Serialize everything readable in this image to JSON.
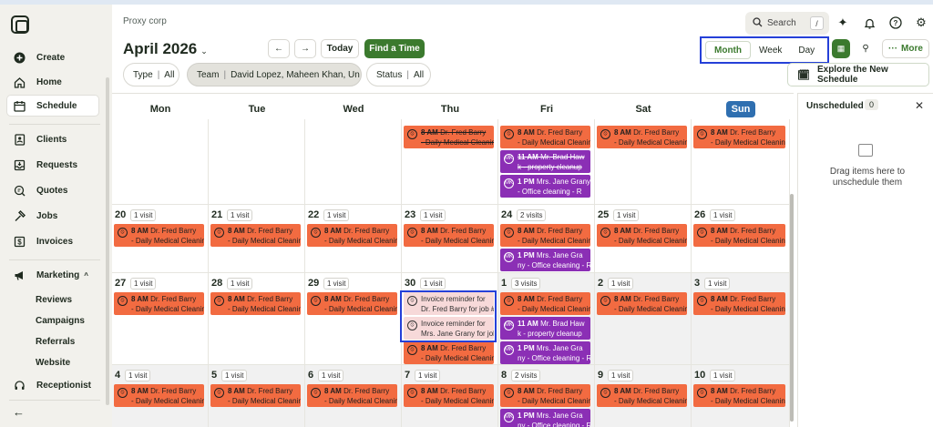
{
  "company": "Proxy corp",
  "header": {
    "month_label": "April 2026",
    "prev_icon": "arrow-left-icon",
    "next_icon": "arrow-right-icon",
    "today_label": "Today",
    "find_time_label": "Find a Time",
    "search_placeholder": "Search",
    "search_shortcut": "/",
    "views": [
      "Month",
      "Week",
      "Day"
    ],
    "active_view": "Month",
    "more_label": "More",
    "explore_label": "Explore the New Schedule"
  },
  "filters": {
    "type": {
      "label": "Type",
      "value": "All"
    },
    "team": {
      "label": "Team",
      "value": "David Lopez, Maheen Khan, Un"
    },
    "status": {
      "label": "Status",
      "value": "All"
    }
  },
  "sidebar": {
    "items": [
      {
        "label": "Create",
        "icon": "plus-circle-icon"
      },
      {
        "label": "Home",
        "icon": "home-icon"
      },
      {
        "label": "Schedule",
        "icon": "calendar-icon"
      },
      {
        "label": "Clients",
        "icon": "contacts-icon"
      },
      {
        "label": "Requests",
        "icon": "inbox-icon"
      },
      {
        "label": "Quotes",
        "icon": "quote-icon"
      },
      {
        "label": "Jobs",
        "icon": "hammer-icon"
      },
      {
        "label": "Invoices",
        "icon": "dollar-icon"
      },
      {
        "label": "Marketing",
        "icon": "megaphone-icon"
      }
    ],
    "marketing_sub": [
      "Reviews",
      "Campaigns",
      "Referrals",
      "Website"
    ],
    "receptionist_label": "Receptionist",
    "active": "Schedule"
  },
  "calendar": {
    "weekdays": [
      "Mon",
      "Tue",
      "Wed",
      "Thu",
      "Fri",
      "Sat",
      "Sun"
    ],
    "today_weekday": "Sun",
    "weeks": [
      {
        "days": [
          {
            "num": "",
            "count": "",
            "events": []
          },
          {
            "num": "",
            "count": "",
            "events": []
          },
          {
            "num": "",
            "count": "",
            "events": []
          },
          {
            "num": "",
            "count": "",
            "events": [
              {
                "c": "or",
                "t": "8 AM",
                "l1": "Dr. Fred Barry",
                "l2": "- Daily Medical Cleanin",
                "strike": true
              }
            ]
          },
          {
            "num": "",
            "count": "",
            "events": [
              {
                "c": "or",
                "t": "8 AM",
                "l1": "Dr. Fred Barry",
                "l2": "- Daily Medical Cleanin"
              },
              {
                "c": "pu",
                "t": "11 AM",
                "l1": "Mr. Brad Haw",
                "l2": "k - property cleanup",
                "strike": true
              },
              {
                "c": "pu",
                "t": "1 PM",
                "l1": "Mrs. Jane Grany",
                "l2": "- Office cleaning - R"
              }
            ]
          },
          {
            "num": "",
            "count": "",
            "events": [
              {
                "c": "or",
                "t": "8 AM",
                "l1": "Dr. Fred Barry",
                "l2": "- Daily Medical Cleanin"
              }
            ]
          },
          {
            "num": "",
            "count": "",
            "events": [
              {
                "c": "or",
                "t": "8 AM",
                "l1": "Dr. Fred Barry",
                "l2": "- Daily Medical Cleanin"
              }
            ]
          }
        ]
      },
      {
        "days": [
          {
            "num": "20",
            "count": "1 visit",
            "events": [
              {
                "c": "or",
                "t": "8 AM",
                "l1": "Dr. Fred Barry",
                "l2": "- Daily Medical Cleanin"
              }
            ]
          },
          {
            "num": "21",
            "count": "1 visit",
            "events": [
              {
                "c": "or",
                "t": "8 AM",
                "l1": "Dr. Fred Barry",
                "l2": "- Daily Medical Cleanin"
              }
            ]
          },
          {
            "num": "22",
            "count": "1 visit",
            "events": [
              {
                "c": "or",
                "t": "8 AM",
                "l1": "Dr. Fred Barry",
                "l2": "- Daily Medical Cleanin"
              }
            ]
          },
          {
            "num": "23",
            "count": "1 visit",
            "events": [
              {
                "c": "or",
                "t": "8 AM",
                "l1": "Dr. Fred Barry",
                "l2": "- Daily Medical Cleanin"
              }
            ]
          },
          {
            "num": "24",
            "count": "2 visits",
            "events": [
              {
                "c": "or",
                "t": "8 AM",
                "l1": "Dr. Fred Barry",
                "l2": "- Daily Medical Cleanin"
              },
              {
                "c": "pu",
                "t": "1 PM",
                "l1": "Mrs. Jane Gra",
                "l2": "ny - Office cleaning - R"
              }
            ]
          },
          {
            "num": "25",
            "count": "1 visit",
            "events": [
              {
                "c": "or",
                "t": "8 AM",
                "l1": "Dr. Fred Barry",
                "l2": "- Daily Medical Cleanin"
              }
            ]
          },
          {
            "num": "26",
            "count": "1 visit",
            "events": [
              {
                "c": "or",
                "t": "8 AM",
                "l1": "Dr. Fred Barry",
                "l2": "- Daily Medical Cleanin"
              }
            ]
          }
        ]
      },
      {
        "days": [
          {
            "num": "27",
            "count": "1 visit",
            "events": [
              {
                "c": "or",
                "t": "8 AM",
                "l1": "Dr. Fred Barry",
                "l2": "- Daily Medical Cleanin"
              }
            ]
          },
          {
            "num": "28",
            "count": "1 visit",
            "events": [
              {
                "c": "or",
                "t": "8 AM",
                "l1": "Dr. Fred Barry",
                "l2": "- Daily Medical Cleanin"
              }
            ]
          },
          {
            "num": "29",
            "count": "1 visit",
            "events": [
              {
                "c": "or",
                "t": "8 AM",
                "l1": "Dr. Fred Barry",
                "l2": "- Daily Medical Cleanin"
              }
            ]
          },
          {
            "num": "30",
            "count": "1 visit",
            "events": [
              {
                "c": "pk",
                "t": "",
                "l1": "Invoice reminder for",
                "l2": "Dr. Fred Barry for job #1"
              },
              {
                "c": "pk",
                "t": "",
                "l1": "Invoice reminder for",
                "l2": "Mrs. Jane Grany for job"
              },
              {
                "c": "or",
                "t": "8 AM",
                "l1": "Dr. Fred Barry",
                "l2": "- Daily Medical Cleanin"
              }
            ]
          },
          {
            "num": "1",
            "count": "3 visits",
            "gray": true,
            "events": [
              {
                "c": "or",
                "t": "8 AM",
                "l1": "Dr. Fred Barry",
                "l2": "- Daily Medical Cleanin"
              },
              {
                "c": "pu",
                "t": "11 AM",
                "l1": "Mr. Brad Haw",
                "l2": "k - property cleanup"
              },
              {
                "c": "pu",
                "t": "1 PM",
                "l1": "Mrs. Jane Gra",
                "l2": "ny - Office cleaning - R"
              }
            ]
          },
          {
            "num": "2",
            "count": "1 visit",
            "gray": true,
            "events": [
              {
                "c": "or",
                "t": "8 AM",
                "l1": "Dr. Fred Barry",
                "l2": "- Daily Medical Cleanin"
              }
            ]
          },
          {
            "num": "3",
            "count": "1 visit",
            "gray": true,
            "events": [
              {
                "c": "or",
                "t": "8 AM",
                "l1": "Dr. Fred Barry",
                "l2": "- Daily Medical Cleanin"
              }
            ]
          }
        ]
      },
      {
        "days": [
          {
            "num": "4",
            "count": "1 visit",
            "gray": true,
            "events": [
              {
                "c": "or",
                "t": "8 AM",
                "l1": "Dr. Fred Barry",
                "l2": "- Daily Medical Cleanin"
              }
            ]
          },
          {
            "num": "5",
            "count": "1 visit",
            "gray": true,
            "events": [
              {
                "c": "or",
                "t": "8 AM",
                "l1": "Dr. Fred Barry",
                "l2": "- Daily Medical Cleanin"
              }
            ]
          },
          {
            "num": "6",
            "count": "1 visit",
            "gray": true,
            "events": [
              {
                "c": "or",
                "t": "8 AM",
                "l1": "Dr. Fred Barry",
                "l2": "- Daily Medical Cleanin"
              }
            ]
          },
          {
            "num": "7",
            "count": "1 visit",
            "gray": true,
            "events": [
              {
                "c": "or",
                "t": "8 AM",
                "l1": "Dr. Fred Barry",
                "l2": "- Daily Medical Cleanin"
              }
            ]
          },
          {
            "num": "8",
            "count": "2 visits",
            "gray": true,
            "events": [
              {
                "c": "or",
                "t": "8 AM",
                "l1": "Dr. Fred Barry",
                "l2": "- Daily Medical Cleanin"
              },
              {
                "c": "pu",
                "t": "1 PM",
                "l1": "Mrs. Jane Gra",
                "l2": "ny - Office cleaning - R"
              }
            ]
          },
          {
            "num": "9",
            "count": "1 visit",
            "gray": true,
            "events": [
              {
                "c": "or",
                "t": "8 AM",
                "l1": "Dr. Fred Barry",
                "l2": "- Daily Medical Cleanin"
              }
            ]
          },
          {
            "num": "10",
            "count": "1 visit",
            "gray": true,
            "events": [
              {
                "c": "or",
                "t": "8 AM",
                "l1": "Dr. Fred Barry",
                "l2": "- Daily Medical Cleanin"
              }
            ]
          }
        ]
      }
    ]
  },
  "unscheduled": {
    "title": "Unscheduled",
    "count": "0",
    "empty_text": "Drag items here to unschedule them"
  },
  "colors": {
    "brand_green": "#3b7a2e",
    "event_orange": "#f26b41",
    "event_purple": "#8b2fb5",
    "highlight_blue": "#2540d8"
  }
}
